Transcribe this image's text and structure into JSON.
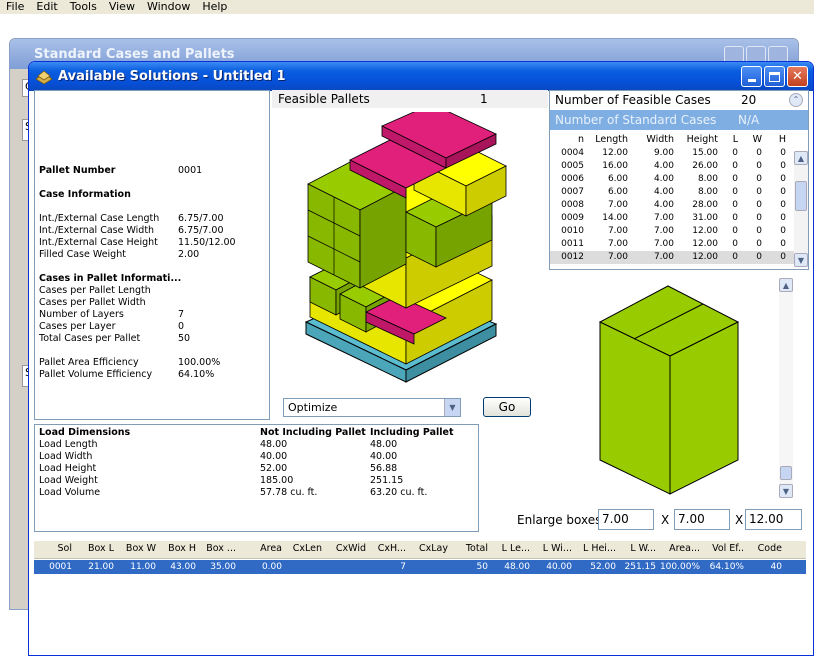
{
  "menu": [
    "File",
    "Edit",
    "Tools",
    "View",
    "Window",
    "Help"
  ],
  "back_window": {
    "title": "Standard Cases and Pallets",
    "tab_fragment": "Ca"
  },
  "window": {
    "title": "Available Solutions - Untitled 1"
  },
  "pallet_info": {
    "pallet_number_label": "Pallet Number",
    "pallet_number": "0001",
    "case_info_header": "Case Information",
    "rows": [
      {
        "label": "Int./External Case Length",
        "value": "6.75/7.00"
      },
      {
        "label": "Int./External Case Width",
        "value": "6.75/7.00"
      },
      {
        "label": "Int./External Case Height",
        "value": "11.50/12.00"
      },
      {
        "label": "Filled Case Weight",
        "value": "2.00"
      }
    ],
    "cases_header": "Cases in Pallet Informati...",
    "cases_rows": [
      {
        "label": "Cases per Pallet Length",
        "value": ""
      },
      {
        "label": "Cases per Pallet Width",
        "value": ""
      },
      {
        "label": "Number of Layers",
        "value": "7"
      },
      {
        "label": "Cases per Layer",
        "value": "0"
      },
      {
        "label": "Total Cases per Pallet",
        "value": "50"
      }
    ],
    "eff_rows": [
      {
        "label": "Pallet Area Efficiency",
        "value": "100.00%"
      },
      {
        "label": "Pallet Volume Efficiency",
        "value": "64.10%"
      }
    ]
  },
  "feasible": {
    "label": "Feasible Pallets",
    "count": "1"
  },
  "cases_panel": {
    "feasible_label": "Number of Feasible Cases",
    "feasible_count": "20",
    "standard_label": "Number of Standard Cases",
    "standard_value": "N/A",
    "columns": [
      "n",
      "Length",
      "Width",
      "Height",
      "L",
      "W",
      "H"
    ],
    "rows": [
      [
        "0004",
        "12.00",
        "9.00",
        "15.00",
        "0",
        "0",
        "0"
      ],
      [
        "0005",
        "16.00",
        "4.00",
        "26.00",
        "0",
        "0",
        "0"
      ],
      [
        "0006",
        "6.00",
        "4.00",
        "8.00",
        "0",
        "0",
        "0"
      ],
      [
        "0007",
        "6.00",
        "4.00",
        "8.00",
        "0",
        "0",
        "0"
      ],
      [
        "0008",
        "7.00",
        "4.00",
        "28.00",
        "0",
        "0",
        "0"
      ],
      [
        "0009",
        "14.00",
        "7.00",
        "31.00",
        "0",
        "0",
        "0"
      ],
      [
        "0010",
        "7.00",
        "7.00",
        "12.00",
        "0",
        "0",
        "0"
      ],
      [
        "0011",
        "7.00",
        "7.00",
        "12.00",
        "0",
        "0",
        "0"
      ],
      [
        "0012",
        "7.00",
        "7.00",
        "12.00",
        "0",
        "0",
        "0"
      ]
    ],
    "selected_row": "0012"
  },
  "optimize": {
    "value": "Optimize"
  },
  "go_label": "Go",
  "load": {
    "header": "Load Dimensions",
    "col1": "Not Including Pallet",
    "col2": "Including Pallet",
    "rows": [
      {
        "label": "Load Length",
        "a": "48.00",
        "b": "48.00"
      },
      {
        "label": "Load Width",
        "a": "40.00",
        "b": "40.00"
      },
      {
        "label": "Load Height",
        "a": "52.00",
        "b": "56.88"
      },
      {
        "label": "Load Weight",
        "a": "185.00",
        "b": "251.15"
      },
      {
        "label": "Load Volume",
        "a": "57.78 cu. ft.",
        "b": "63.20 cu. ft."
      }
    ]
  },
  "enlarge": {
    "label": "Enlarge boxes",
    "x1": "7.00",
    "x2": "7.00",
    "x3": "12.00",
    "sep": "X"
  },
  "solutions": {
    "columns": [
      "Sol",
      "Box L",
      "Box W",
      "Box H",
      "Box ...",
      "Area",
      "CxLen",
      "CxWid",
      "CxH...",
      "CxLay",
      "Total",
      "L Le...",
      "L Wi...",
      "L Hei...",
      "L W...",
      "Area...",
      "Vol Ef..",
      "Code"
    ],
    "rows": [
      [
        "0001",
        "21.00",
        "11.00",
        "43.00",
        "35.00",
        "0.00",
        "",
        "",
        "7",
        "",
        "50",
        "48.00",
        "40.00",
        "52.00",
        "251.15",
        "100.00%",
        "64.10%",
        "40"
      ]
    ]
  },
  "colors": {
    "case_green": "#99cc00",
    "case_yellow": "#ffff00",
    "case_magenta": "#e0207a",
    "pallet_teal": "#5bbccf",
    "selection": "#316ac5"
  }
}
